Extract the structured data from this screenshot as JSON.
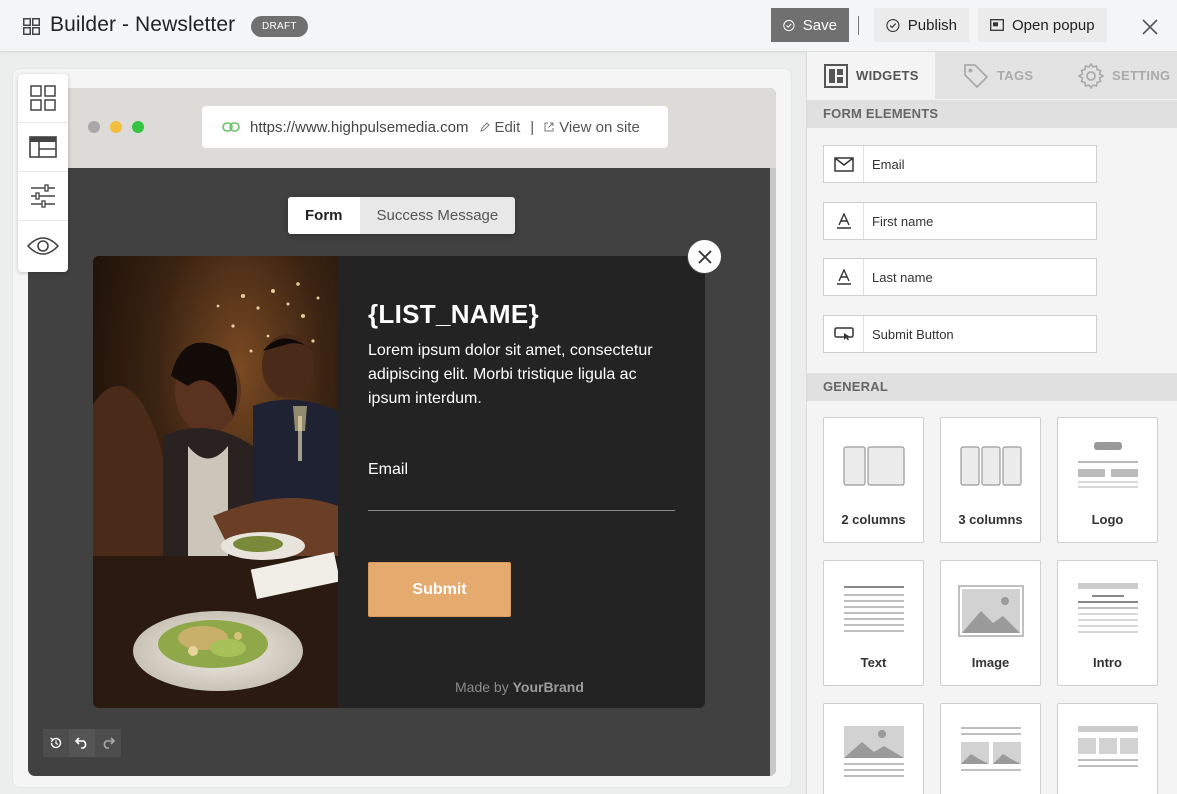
{
  "header": {
    "title": "Builder - Newsletter",
    "badge": "DRAFT",
    "save_label": "Save",
    "publish_label": "Publish",
    "open_popup_label": "Open popup"
  },
  "browser": {
    "url": "https://www.highpulsemedia.com",
    "edit_label": "Edit",
    "separator": "|",
    "view_label": "View on site"
  },
  "tabs": [
    {
      "label": "Form",
      "active": true
    },
    {
      "label": "Success Message",
      "active": false
    }
  ],
  "popup": {
    "title": "{LIST_NAME}",
    "description": "Lorem ipsum dolor sit amet, consectetur adipiscing elit. Morbi tristique ligula ac ipsum interdum.",
    "email_label": "Email",
    "submit_label": "Submit",
    "footer_prefix": "Made by",
    "footer_brand": "YourBrand"
  },
  "left_tools": [
    "widgets-grid-icon",
    "layout-icon",
    "sliders-icon",
    "preview-eye-icon"
  ],
  "right_panel": {
    "tabs": [
      {
        "label": "WIDGETS",
        "icon": "widgets-icon",
        "active": true
      },
      {
        "label": "TAGS",
        "icon": "tag-icon",
        "active": false
      },
      {
        "label": "SETTING",
        "icon": "gear-icon",
        "active": false
      }
    ],
    "form_elements_title": "FORM ELEMENTS",
    "form_elements": [
      {
        "label": "Email",
        "icon": "envelope-icon"
      },
      {
        "label": "First name",
        "icon": "text-field-icon"
      },
      {
        "label": "Last name",
        "icon": "text-field-icon"
      },
      {
        "label": "Submit Button",
        "icon": "button-cursor-icon"
      }
    ],
    "general_title": "GENERAL",
    "general_widgets": [
      {
        "label": "2 columns",
        "icon": "two-columns-icon"
      },
      {
        "label": "3 columns",
        "icon": "three-columns-icon"
      },
      {
        "label": "Logo",
        "icon": "logo-layout-icon"
      },
      {
        "label": "Text",
        "icon": "text-lines-icon"
      },
      {
        "label": "Image",
        "icon": "image-icon"
      },
      {
        "label": "Intro",
        "icon": "intro-layout-icon"
      },
      {
        "label": "",
        "icon": "image-text-icon"
      },
      {
        "label": "",
        "icon": "two-image-text-icon"
      },
      {
        "label": "",
        "icon": "three-image-text-icon"
      }
    ]
  }
}
